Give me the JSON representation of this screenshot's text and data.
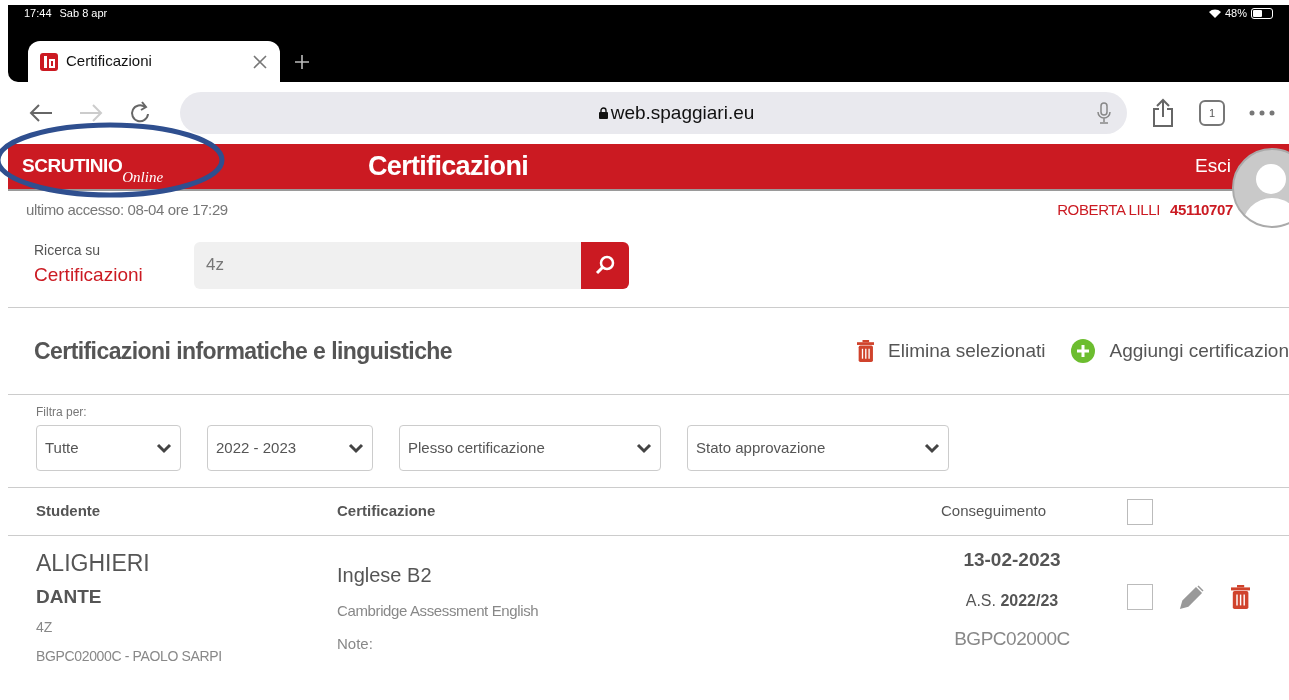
{
  "status_bar": {
    "time": "17:44",
    "date": "Sab 8 apr",
    "battery": "48%"
  },
  "browser": {
    "tab": {
      "title": "Certificazioni"
    },
    "url": "web.spaggiari.eu",
    "tab_count": "1"
  },
  "header": {
    "logo": {
      "brand": "SCRUTINIO",
      "suffix": "Online"
    },
    "title": "Certificazioni",
    "logout": "Esci"
  },
  "annotation": {
    "kind": "ellipse"
  },
  "info": {
    "last_access": "ultimo accesso: 08-04 ore 17:29",
    "user_name": "ROBERTA LILLI",
    "user_code": "45110707"
  },
  "search": {
    "label": "Ricerca su",
    "target": "Certificazioni",
    "value": "4z"
  },
  "section": {
    "title": "Certificazioni informatiche e linguistiche",
    "actions": [
      {
        "kind": "delete",
        "label": "Elimina selezionati"
      },
      {
        "kind": "add",
        "label": "Aggiungi certificazion"
      }
    ]
  },
  "filters": {
    "label": "Filtra per:",
    "dropdowns": [
      "Tutte",
      "2022 - 2023",
      "Plesso certificazione",
      "Stato approvazione"
    ]
  },
  "table": {
    "columns": [
      "Studente",
      "Certificazione",
      "Conseguimento"
    ],
    "select_all_checked": false,
    "rows": [
      {
        "surname": "ALIGHIERI",
        "name": "DANTE",
        "class": "4Z",
        "school": "BGPC02000C - PAOLO SARPI",
        "certification": "Inglese B2",
        "provider": "Cambridge Assessment English",
        "note_label": "Note:",
        "date": "13-02-2023",
        "school_year_prefix": "A.S.",
        "school_year": "2022/23",
        "school_code": "BGPC02000C",
        "checked": false
      }
    ]
  }
}
